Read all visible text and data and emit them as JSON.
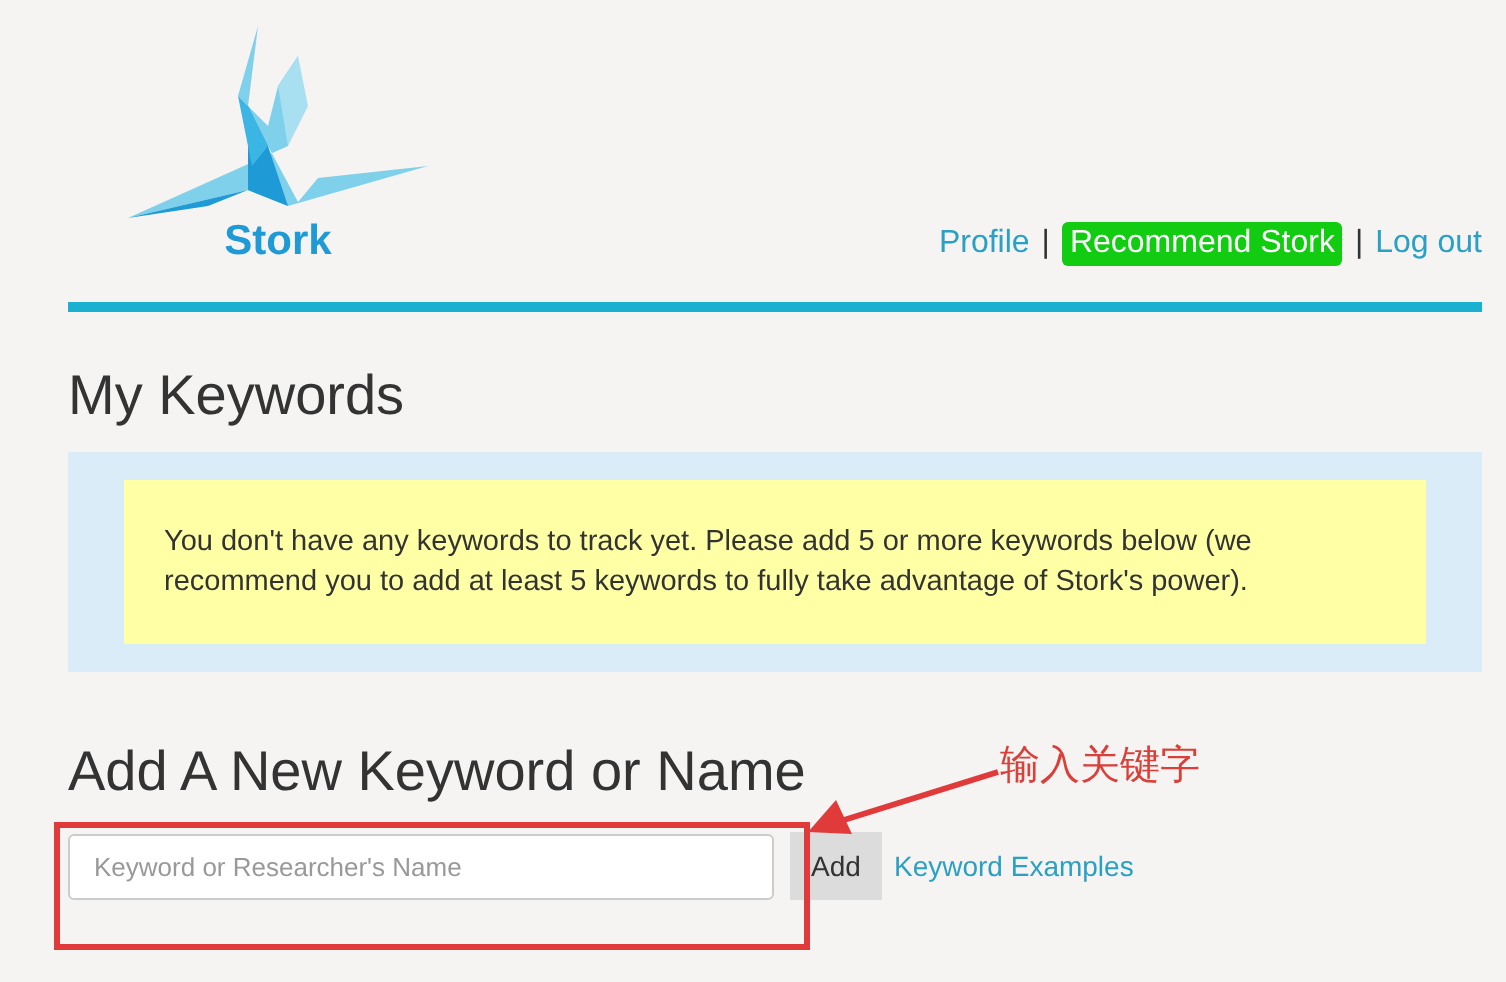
{
  "header": {
    "logo_text": "Stork",
    "nav": [
      {
        "label": "Profile",
        "kind": "link"
      },
      {
        "label": "|",
        "kind": "separator"
      },
      {
        "label": "Recommend Stork",
        "kind": "highlight"
      },
      {
        "label": "|",
        "kind": "separator"
      },
      {
        "label": "Log out",
        "kind": "link"
      }
    ]
  },
  "keywords": {
    "title": "My Keywords",
    "notice": "You don't have any keywords to track yet. Please add 5 or more keywords below (we recommend you to add at least 5 keywords to fully take advantage of Stork's power)."
  },
  "add_form": {
    "title": "Add A New Keyword or Name",
    "placeholder": "Keyword or Researcher's Name",
    "button": "Add",
    "link": "Keyword Examples"
  },
  "annotation": {
    "text": "输入关键字"
  }
}
